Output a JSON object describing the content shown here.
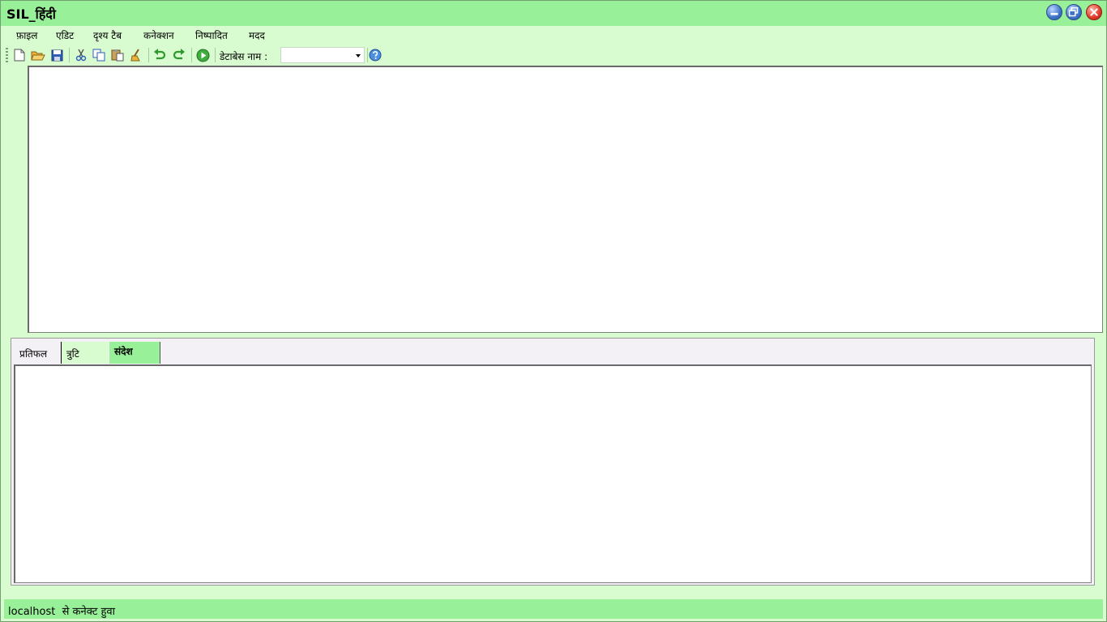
{
  "window": {
    "title": "SIL_हिंदी"
  },
  "menu": [
    "फ़ाइल",
    "एडिट",
    "दृश्य टैब",
    "कनेक्शन",
    "निष्पादित",
    "मदद"
  ],
  "toolbar": {
    "db_label": "डेटाबेस नाम :",
    "db_value": ""
  },
  "tabs": [
    {
      "label": "प्रतिफल"
    },
    {
      "label": "त्रुटि"
    },
    {
      "label": "संदेश",
      "active": true
    }
  ],
  "status": {
    "text": "localhost  से कनेक्ट हुवा"
  },
  "colors": {
    "accent": "#98f098",
    "background": "#d9fbd0"
  }
}
